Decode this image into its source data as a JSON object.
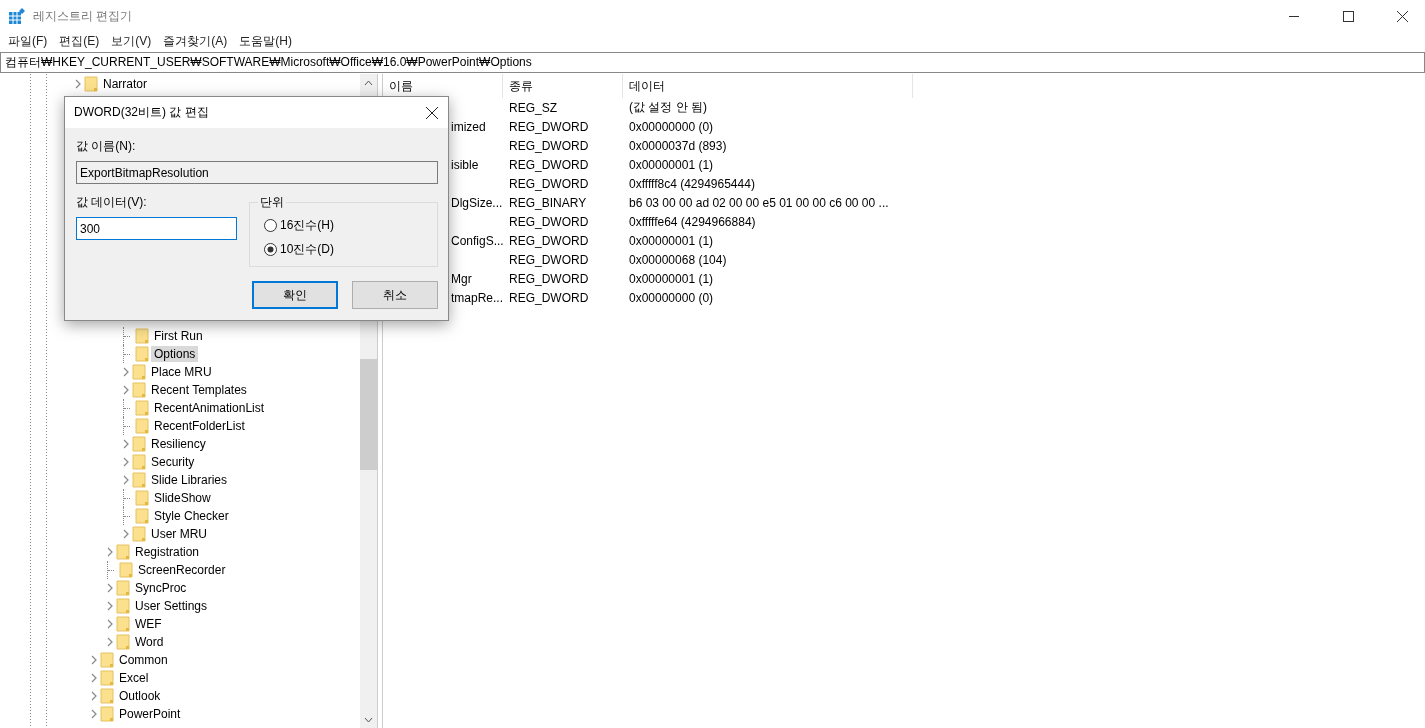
{
  "window": {
    "title": "레지스트리 편집기"
  },
  "menu": [
    "파일(F)",
    "편집(E)",
    "보기(V)",
    "즐겨찾기(A)",
    "도움말(H)"
  ],
  "address": "컴퓨터₩HKEY_CURRENT_USER₩SOFTWARE₩Microsoft₩Office₩16.0₩PowerPoint₩Options",
  "tree": {
    "upper": [
      {
        "label": "Narrator",
        "expandable": true,
        "selected": false
      }
    ],
    "lower": [
      {
        "children": [
          {
            "children": [
              {
                "label": "First Run",
                "expandable": false,
                "selected": false
              },
              {
                "label": "Options",
                "expandable": false,
                "selected": true
              },
              {
                "label": "Place MRU",
                "expandable": true,
                "selected": false
              },
              {
                "label": "Recent Templates",
                "expandable": true,
                "selected": false
              },
              {
                "label": "RecentAnimationList",
                "expandable": false,
                "selected": false
              },
              {
                "label": "RecentFolderList",
                "expandable": false,
                "selected": false
              },
              {
                "label": "Resiliency",
                "expandable": true,
                "selected": false
              },
              {
                "label": "Security",
                "expandable": true,
                "selected": false
              },
              {
                "label": "Slide Libraries",
                "expandable": true,
                "selected": false
              },
              {
                "label": "SlideShow",
                "expandable": false,
                "selected": false
              },
              {
                "label": "Style Checker",
                "expandable": false,
                "selected": false
              },
              {
                "label": "User MRU",
                "expandable": true,
                "selected": false
              }
            ]
          },
          {
            "label": "Registration",
            "expandable": true,
            "selected": false
          },
          {
            "label": "ScreenRecorder",
            "expandable": false,
            "selected": false
          },
          {
            "label": "SyncProc",
            "expandable": true,
            "selected": false
          },
          {
            "label": "User Settings",
            "expandable": true,
            "selected": false
          },
          {
            "label": "WEF",
            "expandable": true,
            "selected": false
          },
          {
            "label": "Word",
            "expandable": true,
            "selected": false
          }
        ]
      },
      {
        "label": "Common",
        "expandable": true,
        "selected": false
      },
      {
        "label": "Excel",
        "expandable": true,
        "selected": false
      },
      {
        "label": "Outlook",
        "expandable": true,
        "selected": false
      },
      {
        "label": "PowerPoint",
        "expandable": true,
        "selected": false
      }
    ]
  },
  "list": {
    "columns": [
      "이름",
      "종류",
      "데이터"
    ],
    "rows": [
      {
        "type": "REG_SZ",
        "data": "(값 설정 안 됨)"
      },
      {
        "name": "imized",
        "type": "REG_DWORD",
        "data": "0x00000000 (0)"
      },
      {
        "type": "REG_DWORD",
        "data": "0x0000037d (893)"
      },
      {
        "name": "isible",
        "type": "REG_DWORD",
        "data": "0x00000001 (1)"
      },
      {
        "type": "REG_DWORD",
        "data": "0xfffff8c4 (4294965444)"
      },
      {
        "name": "DlgSize...",
        "type": "REG_BINARY",
        "data": "b6 03 00 00 ad 02 00 00 e5 01 00 00 c6 00 00 ..."
      },
      {
        "type": "REG_DWORD",
        "data": "0xfffffe64 (4294966884)"
      },
      {
        "name": "ConfigS...",
        "type": "REG_DWORD",
        "data": "0x00000001 (1)"
      },
      {
        "type": "REG_DWORD",
        "data": "0x00000068 (104)"
      },
      {
        "name": "Mgr",
        "type": "REG_DWORD",
        "data": "0x00000001 (1)"
      },
      {
        "name": "tmapRe...",
        "type": "REG_DWORD",
        "data": "0x00000000 (0)"
      }
    ]
  },
  "dialog": {
    "title": "DWORD(32비트) 값 편집",
    "name_label": "값 이름(N):",
    "name_value": "ExportBitmapResolution",
    "data_label": "값 데이터(V):",
    "data_value": "300",
    "base": {
      "label": "단위",
      "options": [
        {
          "label": "16진수(H)",
          "selected": false
        },
        {
          "label": "10진수(D)",
          "selected": true
        }
      ]
    },
    "buttons": [
      {
        "label": "확인",
        "default": true
      },
      {
        "label": "취소",
        "default": false
      }
    ]
  }
}
